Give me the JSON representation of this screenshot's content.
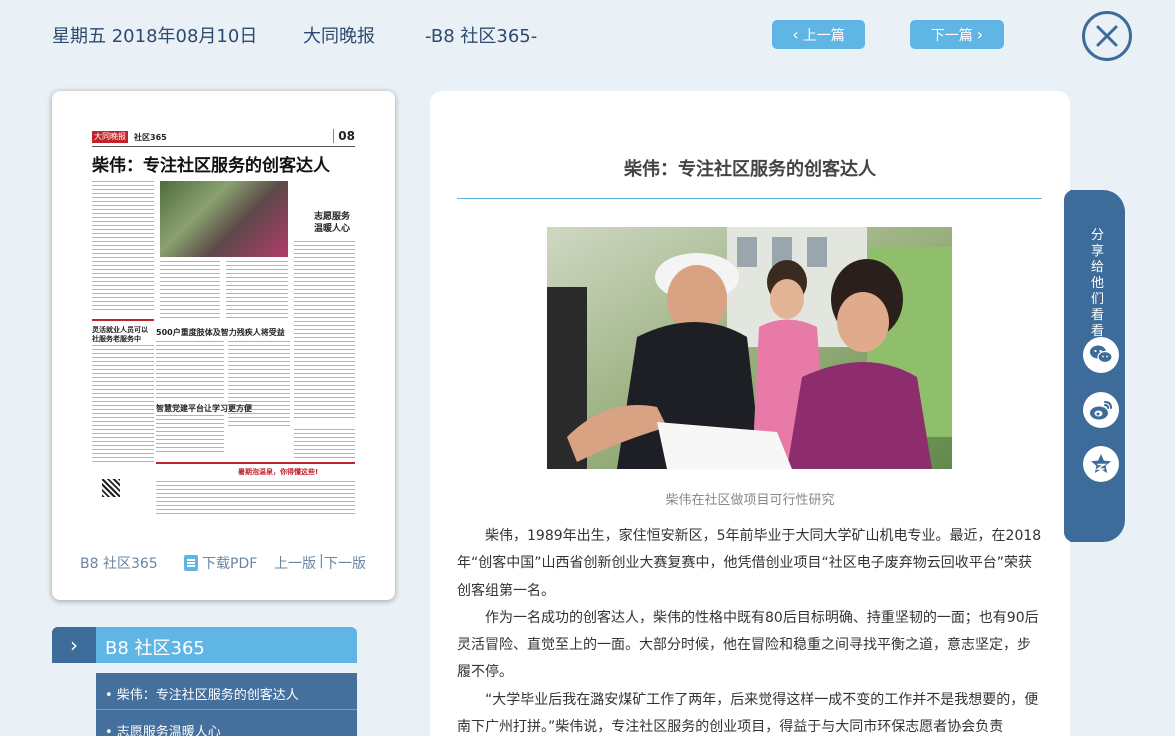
{
  "header": {
    "date": "星期五 2018年08月10日",
    "paper_name": "大同晚报",
    "page_label": "-B8 社区365-",
    "prev_label": "上一篇",
    "next_label": "下一篇"
  },
  "page_card": {
    "thumbnail": {
      "logo_text": "大同晚报",
      "section": "社区365",
      "page_number": "08",
      "headline": "柴伟：专注社区服务的创客达人",
      "sub_heading_1": "志愿服务",
      "sub_heading_2": "温暖人心",
      "sub_heading_3": "500户重度肢体及智力残疾人将受益",
      "sub_heading_4": "智慧党建平台让学习更方便",
      "sub_heading_5": "暑期泡温泉，你得懂这些!",
      "sub_heading_6": "灵活就业人员可以",
      "sub_heading_7": "社服务老服务中"
    },
    "footer": {
      "page_label": "B8 社区365",
      "download_pdf": "下载PDF",
      "prev_page": "上一版",
      "separator": "|",
      "next_page": "下一版"
    }
  },
  "section_list": {
    "title": "B8 社区365",
    "items": [
      "• 柴伟：专注社区服务的创客达人",
      "• 志愿服务温暖人心"
    ]
  },
  "article": {
    "title": "柴伟：专注社区服务的创客达人",
    "photo_caption": "柴伟在社区做项目可行性研究",
    "paragraphs": [
      "柴伟，1989年出生，家住恒安新区，5年前毕业于大同大学矿山机电专业。最近，在2018年“创客中国”山西省创新创业大赛复赛中，他凭借创业项目“社区电子废弃物云回收平台”荣获创客组第一名。",
      "作为一名成功的创客达人，柴伟的性格中既有80后目标明确、持重坚韧的一面；也有90后灵活冒险、直觉至上的一面。大部分时候，他在冒险和稳重之间寻找平衡之道，意志坚定，步履不停。",
      "“大学毕业后我在潞安煤矿工作了两年，后来觉得这样一成不变的工作并不是我想要的，便南下广州打拼。”柴伟说，专注社区服务的创业项目，得益于与大同市环保志愿者协会负责"
    ]
  },
  "share": {
    "label": "分享给他们看看"
  },
  "colors": {
    "accent_blue": "#5fb6e4",
    "dark_blue": "#3d6b9a",
    "section_item_bg": "#45709d",
    "background": "#eaf1f6"
  }
}
